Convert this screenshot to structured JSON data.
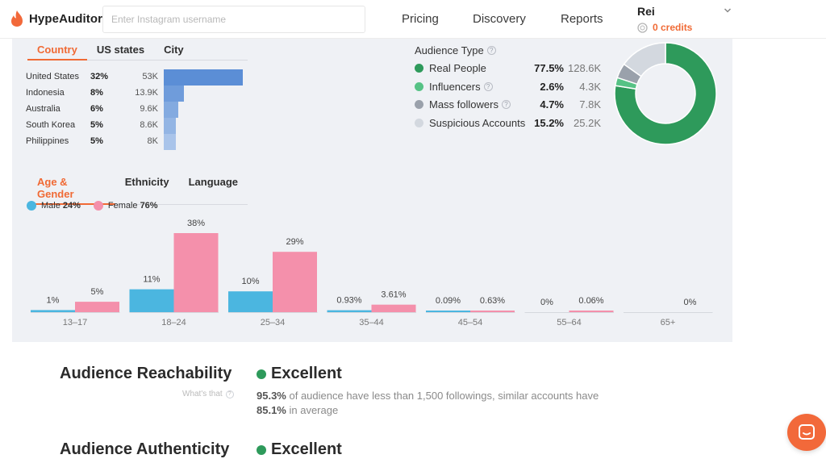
{
  "header": {
    "brand": "HypeAuditor",
    "search_placeholder": "Enter Instagram username",
    "nav": [
      "Pricing",
      "Discovery",
      "Reports"
    ],
    "user_name": "Rei",
    "credits": "0 credits"
  },
  "location": {
    "tabs": [
      "Country",
      "US states",
      "City"
    ],
    "active_tab": "Country",
    "rows": [
      {
        "name": "United States",
        "pct": "32%",
        "count": "53K",
        "value": 32
      },
      {
        "name": "Indonesia",
        "pct": "8%",
        "count": "13.9K",
        "value": 8
      },
      {
        "name": "Australia",
        "pct": "6%",
        "count": "9.6K",
        "value": 6
      },
      {
        "name": "South Korea",
        "pct": "5%",
        "count": "8.6K",
        "value": 5
      },
      {
        "name": "Philippines",
        "pct": "5%",
        "count": "8K",
        "value": 5
      }
    ],
    "bar_colors": [
      "#5b8ed6",
      "#6f9cdb",
      "#83aae0",
      "#93b5e4",
      "#a9c4ea"
    ]
  },
  "audience_type": {
    "title": "Audience Type",
    "rows": [
      {
        "label": "Real People",
        "pct": "77.5%",
        "count": "128.6K",
        "value": 77.5,
        "color": "#2e9a5b",
        "help": false
      },
      {
        "label": "Influencers",
        "pct": "2.6%",
        "count": "4.3K",
        "value": 2.6,
        "color": "#56c285",
        "help": true
      },
      {
        "label": "Mass followers",
        "pct": "4.7%",
        "count": "7.8K",
        "value": 4.7,
        "color": "#9aa1ab",
        "help": true
      },
      {
        "label": "Suspicious Accounts",
        "pct": "15.2%",
        "count": "25.2K",
        "value": 15.2,
        "color": "#d3d8df",
        "help": false
      }
    ]
  },
  "demographics": {
    "tabs": [
      "Age & Gender",
      "Ethnicity",
      "Language"
    ],
    "active_tab": "Age & Gender",
    "legend": {
      "male_label": "Male",
      "male_pct": "24%",
      "female_label": "Female",
      "female_pct": "76%",
      "male_color": "#4bb6e0",
      "female_color": "#f490ab"
    }
  },
  "chart_data": {
    "type": "bar",
    "categories": [
      "13–17",
      "18–24",
      "25–34",
      "35–44",
      "45–54",
      "55–64",
      "65+"
    ],
    "series": [
      {
        "name": "Male",
        "values": [
          1,
          11,
          10,
          0.93,
          0.09,
          0,
          0
        ],
        "labels": [
          "1%",
          "11%",
          "10%",
          "0.93%",
          "0.09%",
          "0%",
          ""
        ]
      },
      {
        "name": "Female",
        "values": [
          5,
          38,
          29,
          3.61,
          0.63,
          0.06,
          0
        ],
        "labels": [
          "5%",
          "38%",
          "29%",
          "3.61%",
          "0.63%",
          "0.06%",
          "0%"
        ]
      }
    ],
    "ylim": [
      0,
      38
    ]
  },
  "reachability": {
    "title": "Audience Reachability",
    "help_text": "What's that",
    "rating": "Excellent",
    "desc_pct1": "95.3%",
    "desc_mid": " of audience have less than 1,500 followings, similar accounts have ",
    "desc_pct2": "85.1%",
    "desc_end": " in average"
  },
  "authenticity": {
    "title": "Audience Authenticity",
    "rating": "Excellent"
  }
}
